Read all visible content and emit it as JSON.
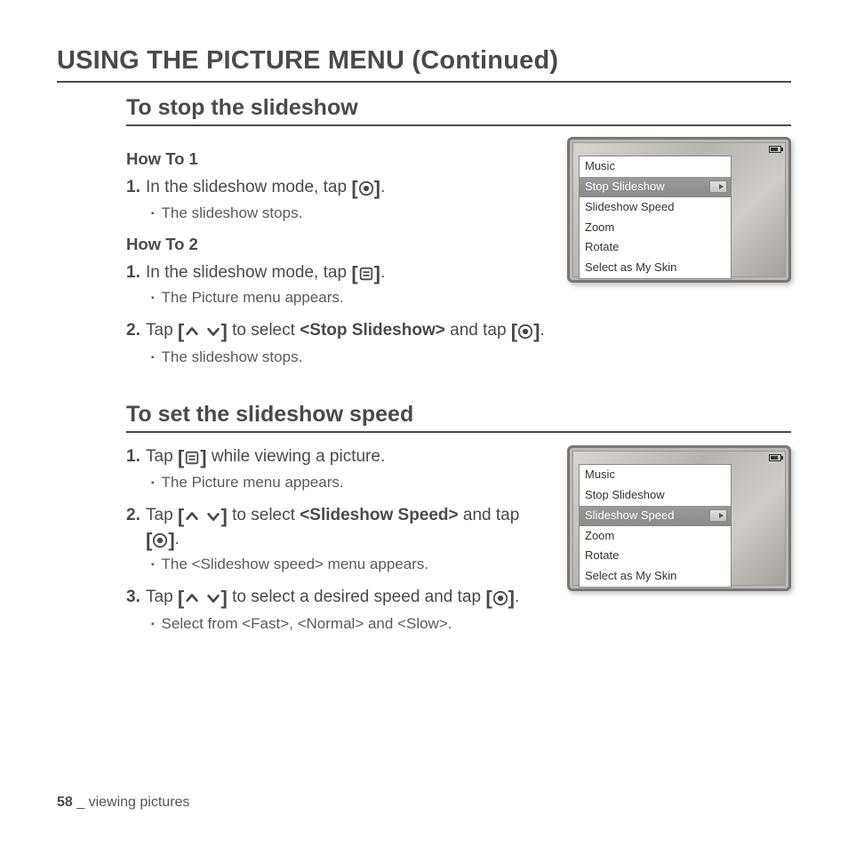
{
  "heading": "USING THE PICTURE MENU (Continued)",
  "section1": {
    "title": "To stop the slideshow",
    "howto1": {
      "label": "How To 1",
      "step1_a": "In the slideshow mode, tap ",
      "step1_b": ".",
      "sub1": "The slideshow stops."
    },
    "howto2": {
      "label": "How To 2",
      "step1_a": "In the slideshow mode, tap ",
      "step1_b": ".",
      "sub1": "The Picture menu appears.",
      "step2_a": "Tap ",
      "step2_b": " to select ",
      "step2_bold": "<Stop Slideshow>",
      "step2_c": " and tap ",
      "step2_d": ".",
      "sub2": "The slideshow stops."
    }
  },
  "section2": {
    "title": "To set the slideshow speed",
    "step1_a": "Tap ",
    "step1_b": " while viewing a picture.",
    "sub1": "The Picture menu appears.",
    "step2_a": "Tap ",
    "step2_b": " to select ",
    "step2_bold": "<Slideshow Speed>",
    "step2_c": " and tap ",
    "step2_d": ".",
    "sub2": "The <Slideshow speed> menu appears.",
    "step3_a": "Tap ",
    "step3_b": " to select a desired speed and tap ",
    "step3_c": ".",
    "sub3": "Select from <Fast>, <Normal> and <Slow>."
  },
  "menu": {
    "items": [
      "Music",
      "Stop Slideshow",
      "Slideshow Speed",
      "Zoom",
      "Rotate",
      "Select as My Skin"
    ]
  },
  "footer": {
    "page": "58",
    "sep": " _ ",
    "text": "viewing pictures"
  },
  "nums": {
    "n1": "1.",
    "n2": "2.",
    "n3": "3."
  },
  "brackets": {
    "open": "[",
    "close": "]"
  }
}
